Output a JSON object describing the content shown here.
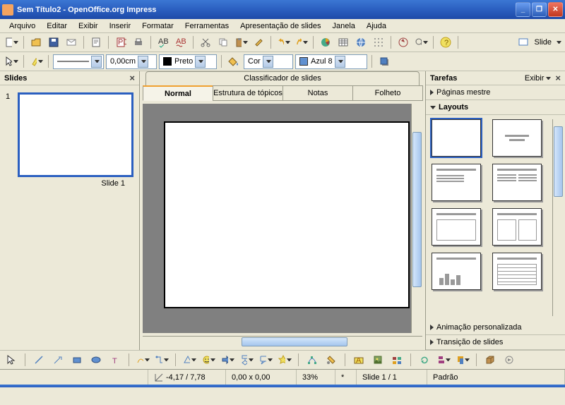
{
  "window": {
    "title": "Sem Título2 - OpenOffice.org Impress"
  },
  "menu": {
    "items": [
      "Arquivo",
      "Editar",
      "Exibir",
      "Inserir",
      "Formatar",
      "Ferramentas",
      "Apresentação de slides",
      "Janela",
      "Ajuda"
    ]
  },
  "toolbar2": {
    "line_width": "0,00cm",
    "line_color": "Preto",
    "fill_label": "Cor",
    "fill_color": "Azul 8"
  },
  "right_toolbar": {
    "slide_label": "Slide"
  },
  "slides_panel": {
    "title": "Slides",
    "slide1_num": "1",
    "slide1_label": "Slide 1"
  },
  "center": {
    "sorter": "Classificador de slides",
    "tabs": {
      "normal": "Normal",
      "outline": "Estrutura de tópicos",
      "notes": "Notas",
      "handout": "Folheto"
    }
  },
  "tasks_panel": {
    "title": "Tarefas",
    "view_menu": "Exibir",
    "master": "Páginas mestre",
    "layouts": "Layouts",
    "anim": "Animação personalizada",
    "trans": "Transição de slides"
  },
  "status": {
    "pos": "-4,17 / 7,78",
    "size": "0,00 x 0,00",
    "zoom": "33%",
    "slide": "Slide 1 / 1",
    "style": "Padrão"
  }
}
